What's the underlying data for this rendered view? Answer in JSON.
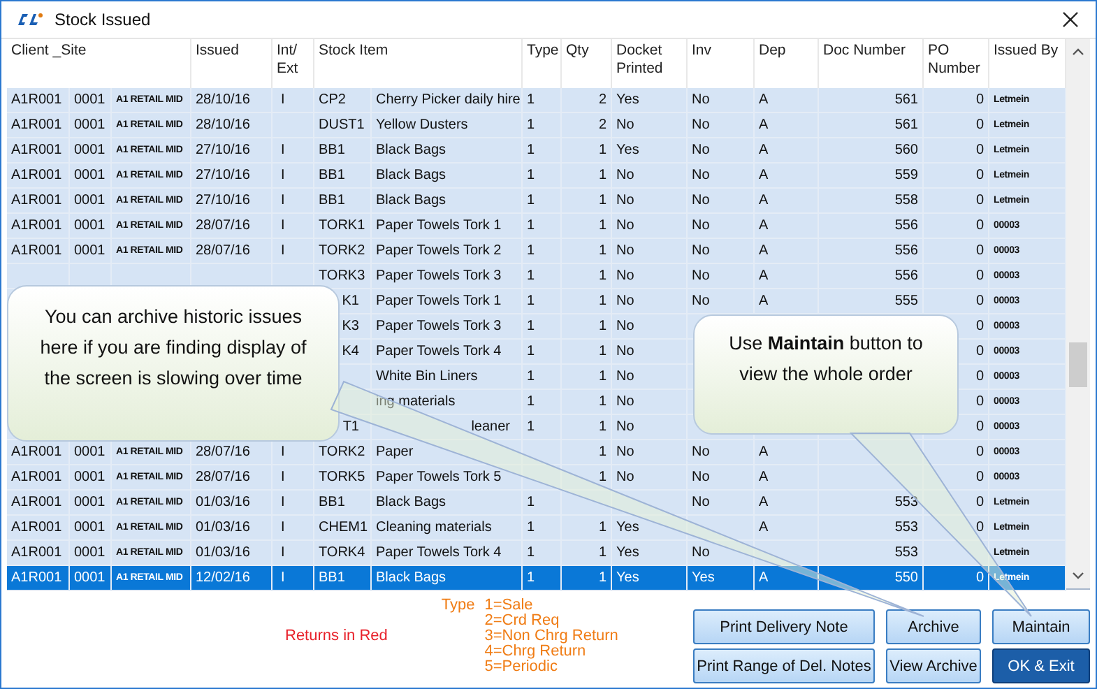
{
  "window": {
    "title": "Stock Issued"
  },
  "table": {
    "columns": [
      "Client _Site",
      "Issued",
      "Int/ Ext",
      "Stock Item",
      "Type",
      "Qty",
      "Docket Printed",
      "Inv",
      "Dep",
      "Doc Number",
      "PO Number",
      "Issued By"
    ],
    "rows": [
      {
        "client": "A1R001",
        "site_code": "0001",
        "site_name": "A1 RETAIL MID",
        "issued": "28/10/16",
        "int_ext": "I",
        "code": "CP2",
        "item": "Cherry Picker daily hire",
        "type": "1",
        "qty": "2",
        "docket_printed": "Yes",
        "inv": "No",
        "dep": "A",
        "doc_number": "561",
        "po_number": "0",
        "issued_by": "Letmein",
        "selected": false
      },
      {
        "client": "A1R001",
        "site_code": "0001",
        "site_name": "A1 RETAIL MID",
        "issued": "28/10/16",
        "code": "DUST1",
        "item": "Yellow Dusters",
        "type": "1",
        "qty": "2",
        "docket_printed": "No",
        "inv": "No",
        "dep": "A",
        "doc_number": "561",
        "po_number": "0",
        "issued_by": "Letmein",
        "selected": false
      },
      {
        "client": "A1R001",
        "site_code": "0001",
        "site_name": "A1 RETAIL MID",
        "issued": "27/10/16",
        "int_ext": "I",
        "code": "BB1",
        "item": "Black Bags",
        "type": "1",
        "qty": "1",
        "docket_printed": "Yes",
        "inv": "No",
        "dep": "A",
        "doc_number": "560",
        "po_number": "0",
        "issued_by": "Letmein",
        "selected": false
      },
      {
        "client": "A1R001",
        "site_code": "0001",
        "site_name": "A1 RETAIL MID",
        "issued": "27/10/16",
        "int_ext": "I",
        "code": "BB1",
        "item": "Black Bags",
        "type": "1",
        "qty": "1",
        "docket_printed": "No",
        "inv": "No",
        "dep": "A",
        "doc_number": "559",
        "po_number": "0",
        "issued_by": "Letmein",
        "selected": false
      },
      {
        "client": "A1R001",
        "site_code": "0001",
        "site_name": "A1 RETAIL MID",
        "issued": "27/10/16",
        "int_ext": "I",
        "code": "BB1",
        "item": "Black Bags",
        "type": "1",
        "qty": "1",
        "docket_printed": "No",
        "inv": "No",
        "dep": "A",
        "doc_number": "558",
        "po_number": "0",
        "issued_by": "Letmein",
        "selected": false
      },
      {
        "client": "A1R001",
        "site_code": "0001",
        "site_name": "A1 RETAIL MID",
        "issued": "28/07/16",
        "int_ext": "I",
        "code": "TORK1",
        "item": "Paper Towels Tork 1",
        "type": "1",
        "qty": "1",
        "docket_printed": "No",
        "inv": "No",
        "dep": "A",
        "doc_number": "556",
        "po_number": "0",
        "issued_by": "00003",
        "selected": false
      },
      {
        "client": "A1R001",
        "site_code": "0001",
        "site_name": "A1 RETAIL MID",
        "issued": "28/07/16",
        "int_ext": "I",
        "code": "TORK2",
        "item": "Paper Towels Tork 2",
        "type": "1",
        "qty": "1",
        "docket_printed": "No",
        "inv": "No",
        "dep": "A",
        "doc_number": "556",
        "po_number": "0",
        "issued_by": "00003",
        "selected": false
      },
      {
        "code": "TORK3",
        "item": "Paper Towels Tork 3",
        "type": "1",
        "qty": "1",
        "docket_printed": "No",
        "inv": "No",
        "dep": "A",
        "doc_number": "556",
        "po_number": "0",
        "issued_by": "00003",
        "selected": false
      },
      {
        "code": "K1",
        "code_partial": true,
        "item": "Paper Towels Tork 1",
        "type": "1",
        "qty": "1",
        "docket_printed": "No",
        "inv": "No",
        "dep": "A",
        "doc_number": "555",
        "po_number": "0",
        "issued_by": "00003",
        "selected": false
      },
      {
        "code": "K3",
        "code_partial": true,
        "item": "Paper Towels Tork 3",
        "type": "1",
        "qty": "1",
        "docket_printed": "No",
        "po_number": "0",
        "issued_by": "00003",
        "selected": false
      },
      {
        "code": "K4",
        "code_partial": true,
        "item": "Paper Towels Tork 4",
        "type": "1",
        "qty": "1",
        "docket_printed": "No",
        "po_number": "0",
        "issued_by": "00003",
        "selected": false
      },
      {
        "item": "White Bin Liners",
        "type": "1",
        "qty": "1",
        "docket_printed": "No",
        "po_number": "0",
        "issued_by": "00003",
        "selected": false
      },
      {
        "item": "ing materials",
        "type": "1",
        "qty": "1",
        "docket_printed": "No",
        "po_number": "0",
        "issued_by": "00003",
        "selected": false
      },
      {
        "code": "T1",
        "code_partial": true,
        "item": "leaner",
        "item_partial": true,
        "type": "1",
        "qty": "1",
        "docket_printed": "No",
        "po_number": "0",
        "issued_by": "00003",
        "selected": false
      },
      {
        "client": "A1R001",
        "site_code": "0001",
        "site_name": "A1 RETAIL MID",
        "issued": "28/07/16",
        "int_ext": "I",
        "code": "TORK2",
        "item": "Paper",
        "qty": "1",
        "docket_printed": "No",
        "inv": "No",
        "dep": "A",
        "po_number": "0",
        "issued_by": "00003",
        "selected": false
      },
      {
        "client": "A1R001",
        "site_code": "0001",
        "site_name": "A1 RETAIL MID",
        "issued": "28/07/16",
        "int_ext": "I",
        "code": "TORK5",
        "item": "Paper Towels Tork 5",
        "qty": "1",
        "docket_printed": "No",
        "inv": "No",
        "dep": "A",
        "po_number": "0",
        "issued_by": "00003",
        "selected": false
      },
      {
        "client": "A1R001",
        "site_code": "0001",
        "site_name": "A1 RETAIL MID",
        "issued": "01/03/16",
        "int_ext": "I",
        "code": "BB1",
        "item": "Black Bags",
        "type": "1",
        "inv": "No",
        "dep": "A",
        "doc_number": "553",
        "po_number": "0",
        "issued_by": "Letmein",
        "selected": false
      },
      {
        "client": "A1R001",
        "site_code": "0001",
        "site_name": "A1 RETAIL MID",
        "issued": "01/03/16",
        "int_ext": "I",
        "code": "CHEM1",
        "item": "Cleaning materials",
        "type": "1",
        "qty": "1",
        "docket_printed": "Yes",
        "dep": "A",
        "doc_number": "553",
        "po_number": "0",
        "issued_by": "Letmein",
        "selected": false
      },
      {
        "client": "A1R001",
        "site_code": "0001",
        "site_name": "A1 RETAIL MID",
        "issued": "01/03/16",
        "int_ext": "I",
        "code": "TORK4",
        "item": "Paper Towels Tork 4",
        "type": "1",
        "qty": "1",
        "docket_printed": "Yes",
        "inv": "No",
        "doc_number": "553",
        "issued_by": "Letmein",
        "selected": false
      },
      {
        "client": "A1R001",
        "site_code": "0001",
        "site_name": "A1 RETAIL MID",
        "issued": "12/02/16",
        "int_ext": "I",
        "code": "BB1",
        "item": "Black Bags",
        "type": "1",
        "qty": "1",
        "docket_printed": "Yes",
        "inv": "Yes",
        "dep": "A",
        "doc_number": "550",
        "po_number": "0",
        "issued_by": "Letmein",
        "selected": true
      }
    ]
  },
  "footer": {
    "returns_note": "Returns in Red",
    "type_legend": {
      "label": "Type",
      "entries": [
        "1=Sale",
        "2=Crd Req",
        "3=Non Chrg Return",
        "4=Chrg Return",
        "5=Periodic"
      ]
    },
    "buttons": [
      {
        "label": "Print Delivery Note",
        "kind": "normal"
      },
      {
        "label": "Archive",
        "kind": "normal"
      },
      {
        "label": "Maintain",
        "kind": "normal"
      },
      {
        "label": "Print Range of Del. Notes",
        "kind": "normal"
      },
      {
        "label": "View Archive",
        "kind": "normal"
      },
      {
        "label": "OK & Exit",
        "kind": "default"
      }
    ]
  },
  "callouts": [
    {
      "text": "You can archive historic issues here if you are finding display of the screen is slowing over time"
    },
    {
      "text": "Use **Maintain** button to view the whole order"
    }
  ]
}
